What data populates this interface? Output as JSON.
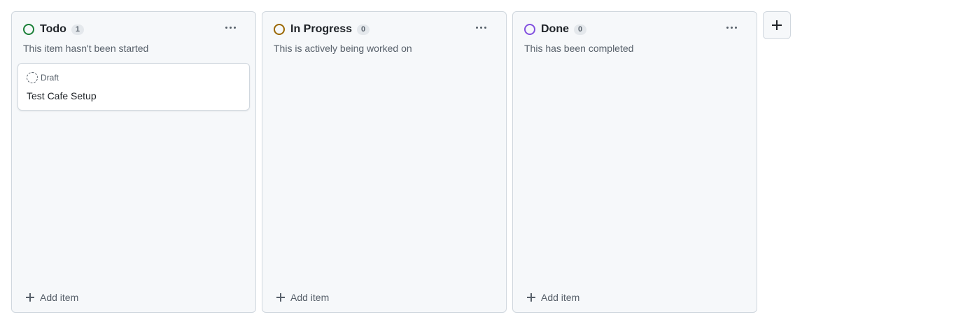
{
  "columns": [
    {
      "title": "Todo",
      "count": "1",
      "description": "This item hasn't been started",
      "status_color": "#1a7f37",
      "add_item_label": "Add item",
      "cards": [
        {
          "meta_label": "Draft",
          "title": "Test Cafe Setup"
        }
      ]
    },
    {
      "title": "In Progress",
      "count": "0",
      "description": "This is actively being worked on",
      "status_color": "#9a6700",
      "add_item_label": "Add item",
      "cards": []
    },
    {
      "title": "Done",
      "count": "0",
      "description": "This has been completed",
      "status_color": "#8250df",
      "add_item_label": "Add item",
      "cards": []
    }
  ],
  "icons": {
    "status": "circle-status-icon",
    "more": "kebab-horizontal-icon",
    "draft": "draft-issue-icon",
    "add": "plus-icon"
  },
  "add_column_label": "+"
}
